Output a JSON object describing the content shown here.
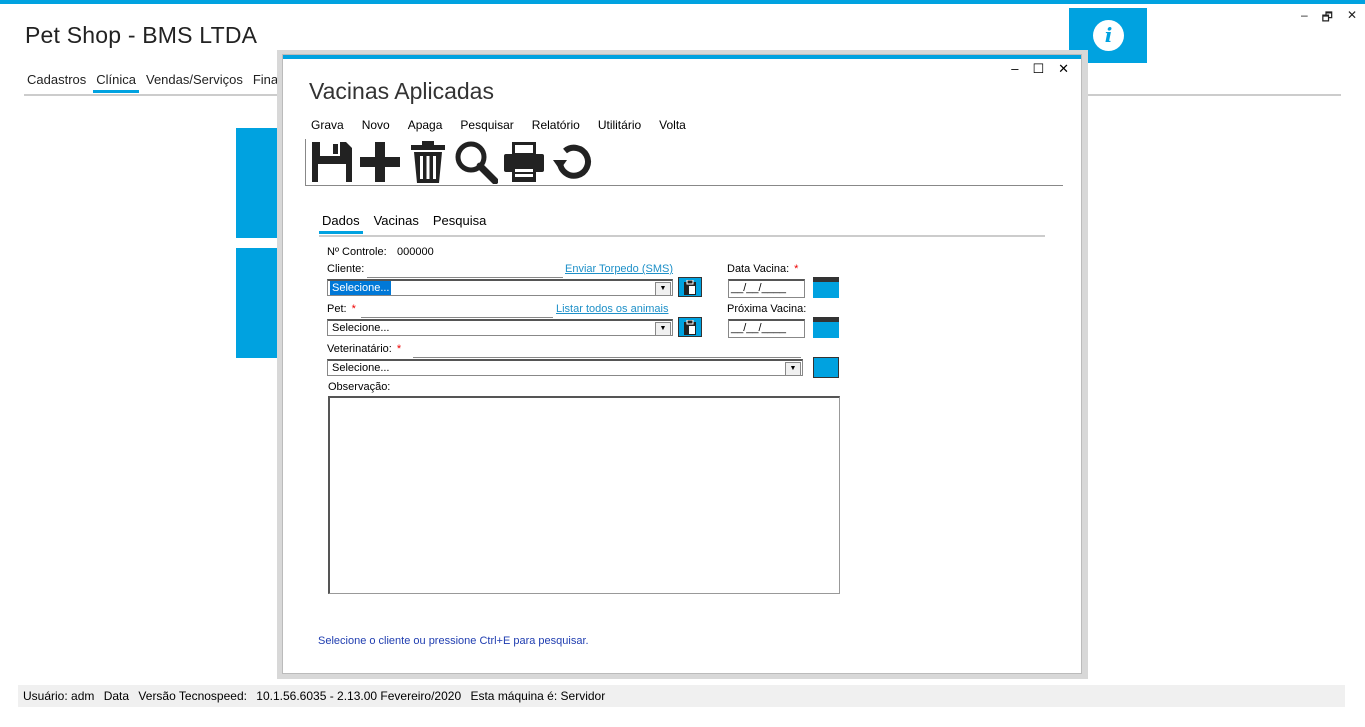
{
  "app": {
    "title": "Pet Shop - BMS LTDA",
    "window_controls": {
      "minimize": "–",
      "restore": "🗗",
      "close": "✕"
    },
    "info_glyph": "i"
  },
  "main_menu": {
    "items": [
      {
        "label": "Cadastros"
      },
      {
        "label": "Clínica",
        "active": true
      },
      {
        "label": "Vendas/Serviços"
      },
      {
        "label": "Finan"
      }
    ]
  },
  "dialog": {
    "title": "Vacinas Aplicadas",
    "controls": {
      "minimize": "–",
      "maximize": "☐",
      "close": "✕"
    },
    "menu": [
      "Grava",
      "Novo",
      "Apaga",
      "Pesquisar",
      "Relatório",
      "Utilitário",
      "Volta"
    ],
    "toolbar_icons": [
      "save-icon",
      "plus-icon",
      "trash-icon",
      "search-icon",
      "print-icon",
      "undo-icon"
    ],
    "tabs": [
      {
        "label": "Dados",
        "active": true
      },
      {
        "label": "Vacinas"
      },
      {
        "label": "Pesquisa"
      }
    ],
    "form": {
      "controle_label": "Nº Controle:",
      "controle_value": "000000",
      "cliente_label": "Cliente:",
      "cliente_value": "Selecione...",
      "sms_link": "Enviar Torpedo (SMS)",
      "pet_label": "Pet:",
      "pet_value": "Selecione...",
      "listar_link": "Listar todos os animais",
      "vet_label": "Veterinatário:",
      "vet_value": "Selecione...",
      "obs_label": "Observação:",
      "data_vacina_label": "Data Vacina:",
      "data_vacina_value": "__/__/____",
      "proxima_label": "Próxima Vacina:",
      "proxima_value": "__/__/____",
      "required_mark": "*"
    },
    "hint": "Selecione o cliente ou pressione Ctrl+E para pesquisar."
  },
  "status_bar": {
    "items": [
      "Usuário: adm",
      "Data",
      "Versão Tecnospeed:",
      "10.1.56.6035 - 2.13.00 Fevereiro/2020",
      "Esta máquina é: Servidor"
    ]
  },
  "colors": {
    "accent": "#00A2E0",
    "link": "#1E90C8",
    "hint": "#1F3DB0",
    "required": "#EE0000"
  }
}
